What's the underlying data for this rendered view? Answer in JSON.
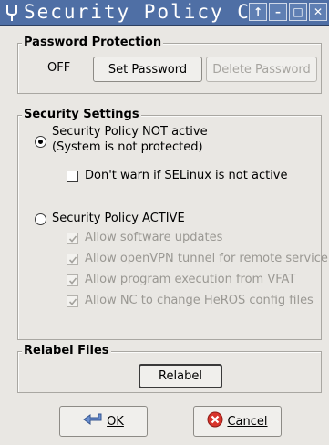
{
  "window": {
    "title": "Security Policy C",
    "buttons": [
      "↑",
      "–",
      "□",
      "✕"
    ]
  },
  "password_protection": {
    "legend": "Password Protection",
    "status": "OFF",
    "set_label": "Set Password",
    "delete_label": "Delete Password"
  },
  "security_settings": {
    "legend": "Security Settings",
    "option_not_active": {
      "line1": "Security Policy NOT active",
      "line2": "(System is not protected)",
      "selected": true
    },
    "dont_warn": {
      "label": "Don't warn if SELinux is not active",
      "checked": false
    },
    "option_active": {
      "label": "Security Policy ACTIVE",
      "selected": false
    },
    "active_options": [
      {
        "label": "Allow software updates",
        "checked": true
      },
      {
        "label": "Allow openVPN tunnel for remote service",
        "checked": true
      },
      {
        "label": "Allow program execution from VFAT",
        "checked": true
      },
      {
        "label": "Allow NC to change HeROS config files",
        "checked": true
      }
    ]
  },
  "relabel": {
    "legend": "Relabel Files",
    "button_label": "Relabel"
  },
  "footer": {
    "ok_label": "OK",
    "ok_mnemonic": "O",
    "cancel_label": "Cancel",
    "cancel_mnemonic": "C"
  },
  "colors": {
    "titlebar": "#4f6fa5",
    "background": "#e9e7e3",
    "cancel_icon": "#d8342b",
    "ok_arrow": "#6a8fd0"
  }
}
